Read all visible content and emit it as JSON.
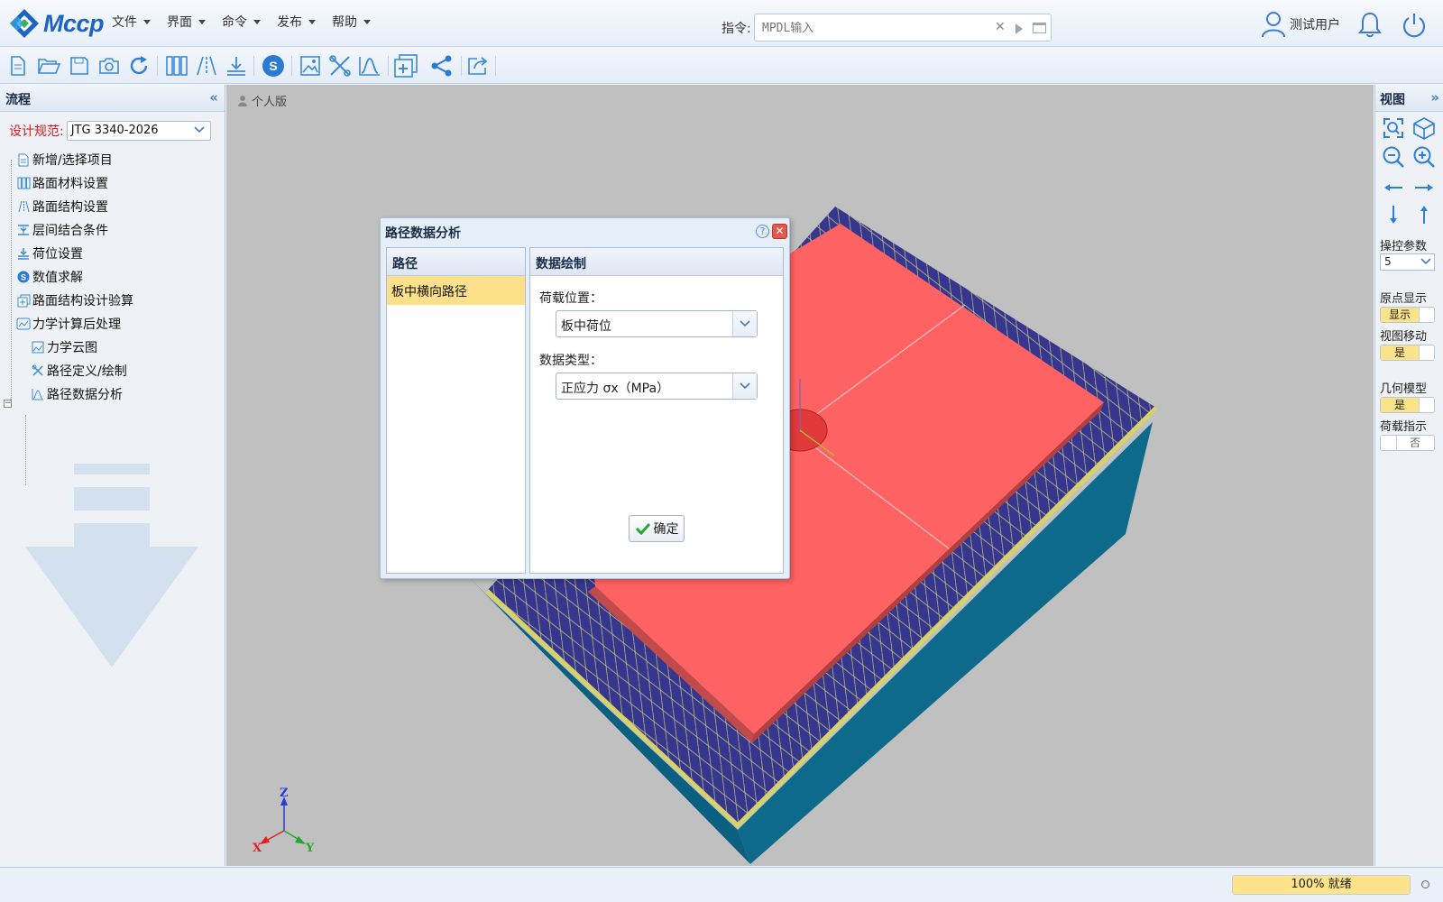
{
  "app": {
    "logo_text": "Mccp"
  },
  "menu": [
    {
      "label": "文件"
    },
    {
      "label": "界面"
    },
    {
      "label": "命令"
    },
    {
      "label": "发布"
    },
    {
      "label": "帮助"
    }
  ],
  "command": {
    "label": "指令:",
    "placeholder": "MPDL输入"
  },
  "user": {
    "name": "测试用户"
  },
  "toolbar": {
    "icons": [
      "new-file-icon",
      "open-folder-icon",
      "save-icon",
      "camera-icon",
      "refresh-icon",
      "material-columns-icon",
      "structure-icon",
      "interlayer-icon",
      "solve-icon",
      "image-icon",
      "path-define-icon",
      "path-chart-icon",
      "add-layer-icon",
      "share-icon",
      "export-icon"
    ]
  },
  "left_panel": {
    "title": "流程",
    "spec_label": "设计规范:",
    "spec_value": "JTG 3340-2026",
    "tree": [
      {
        "label": "新增/选择项目",
        "icon": "document-icon"
      },
      {
        "label": "路面材料设置",
        "icon": "material-icon"
      },
      {
        "label": "路面结构设置",
        "icon": "structure-icon"
      },
      {
        "label": "层间结合条件",
        "icon": "interlayer-icon"
      },
      {
        "label": "荷位设置",
        "icon": "load-icon"
      },
      {
        "label": "数值求解",
        "icon": "solve-icon"
      },
      {
        "label": "路面结构设计验算",
        "icon": "check-icon"
      },
      {
        "label": "力学计算后处理",
        "icon": "postprocess-icon"
      },
      {
        "label": "力学云图",
        "icon": "contour-icon"
      },
      {
        "label": "路径定义/绘制",
        "icon": "path-define-icon"
      },
      {
        "label": "路径数据分析",
        "icon": "path-chart-icon"
      }
    ]
  },
  "viewport": {
    "edition": "个人版",
    "axes": {
      "x": "X",
      "y": "Y",
      "z": "Z"
    }
  },
  "right_panel": {
    "title": "视图",
    "param_label": "操控参数",
    "param_value": "5",
    "origin_label": "原点显示",
    "origin_value": "显示",
    "move_label": "视图移动",
    "move_value": "是",
    "geom_label": "几何模型",
    "geom_value": "是",
    "load_label": "荷载指示",
    "load_value": "否"
  },
  "dialog": {
    "title": "路径数据分析",
    "help": "?",
    "path_header": "路径",
    "path_item": "板中横向路径",
    "data_header": "数据绘制",
    "load_pos_label": "荷载位置：",
    "load_pos_value": "板中荷位",
    "data_type_label": "数据类型：",
    "data_type_value": "正应力 σx（MPa）",
    "ok_label": "确定"
  },
  "status": {
    "progress_text": "100% 就绪",
    "progress": 1.0
  },
  "colors": {
    "accent": "#1d63c4",
    "slab": "#ff6262",
    "mesh": "#35358f",
    "base": "#0e6a8a",
    "selected": "#fde18a"
  }
}
